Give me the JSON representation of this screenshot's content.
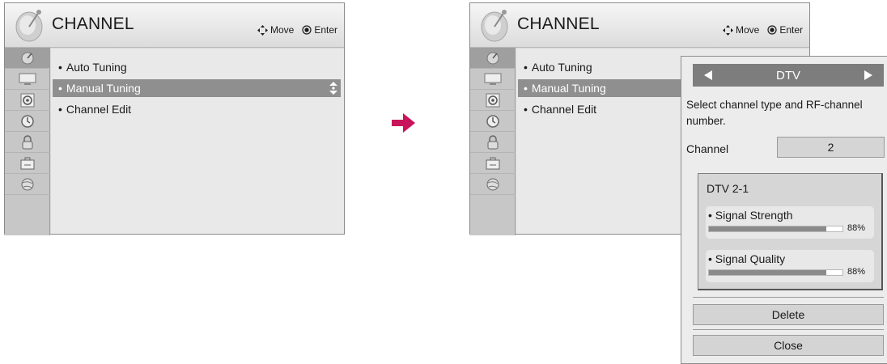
{
  "left_menu": {
    "title": "CHANNEL",
    "hint_move": "Move",
    "hint_enter": "Enter",
    "items": [
      {
        "label": "Auto Tuning"
      },
      {
        "label": "Manual Tuning"
      },
      {
        "label": "Channel Edit"
      }
    ],
    "selected_index": 1
  },
  "right_menu": {
    "title": "CHANNEL",
    "hint_move": "Move",
    "hint_enter": "Enter",
    "items": [
      {
        "label": "Auto Tuning"
      },
      {
        "label": "Manual Tuning"
      },
      {
        "label": "Channel Edit"
      }
    ],
    "selected_index": 1
  },
  "side_icons": [
    "satellite-dish-icon",
    "tv-screen-icon",
    "speaker-icon",
    "clock-icon",
    "lock-icon",
    "toolbox-icon",
    "globe-icon"
  ],
  "popup": {
    "type_value": "DTV",
    "description": "Select channel type and RF-channel number.",
    "channel_label": "Channel",
    "channel_value": "2",
    "signal": {
      "title": "DTV 2-1",
      "strength_label": "• Signal Strength",
      "strength_value": 88,
      "strength_text": "88%",
      "quality_label": "• Signal Quality",
      "quality_value": 88,
      "quality_text": "88%"
    },
    "delete_label": "Delete",
    "close_label": "Close"
  },
  "colors": {
    "transition_arrow": "#c8145a",
    "selected_item": "#8f8f8f",
    "popup_topbar": "#7d7d7d"
  }
}
